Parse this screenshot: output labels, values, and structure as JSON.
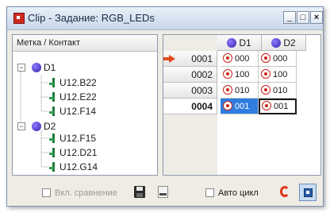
{
  "window": {
    "title": "Clip - Задание: RGB_LEDs",
    "minimize": "_",
    "maximize": "□",
    "close": "×"
  },
  "tree": {
    "header": "Метка / Контакт",
    "groups": [
      {
        "label": "D1",
        "expander": "−",
        "pins": [
          "U12.B22",
          "U12.E22",
          "U12.F14"
        ]
      },
      {
        "label": "D2",
        "expander": "−",
        "pins": [
          "U12.F15",
          "U12.D21",
          "U12.G14"
        ]
      }
    ]
  },
  "grid": {
    "columns": [
      "D1",
      "D2"
    ],
    "rows": [
      {
        "id": "0001",
        "current": true,
        "values": [
          "000",
          "000"
        ]
      },
      {
        "id": "0002",
        "current": false,
        "values": [
          "100",
          "100"
        ]
      },
      {
        "id": "0003",
        "current": false,
        "values": [
          "010",
          "010"
        ]
      },
      {
        "id": "0004",
        "current": false,
        "bold": true,
        "values": [
          "001",
          "001"
        ]
      }
    ]
  },
  "bottom": {
    "compare_label": "Вкл. сравнение",
    "auto_cycle_label": "Авто цикл"
  },
  "icons": {
    "app": "app-icon",
    "bus": "bus-icon",
    "pin": "pin-icon",
    "value": "value-icon",
    "current_row": "arrow-right-icon",
    "save": "save-icon",
    "load": "load-icon",
    "refresh": "refresh-icon",
    "toggle": "toggle-view-icon"
  },
  "colors": {
    "selection": "#2f7de0",
    "arrow": "#e04a1c",
    "value_icon": "#c6231b",
    "bus_icon": "#3422a8"
  }
}
